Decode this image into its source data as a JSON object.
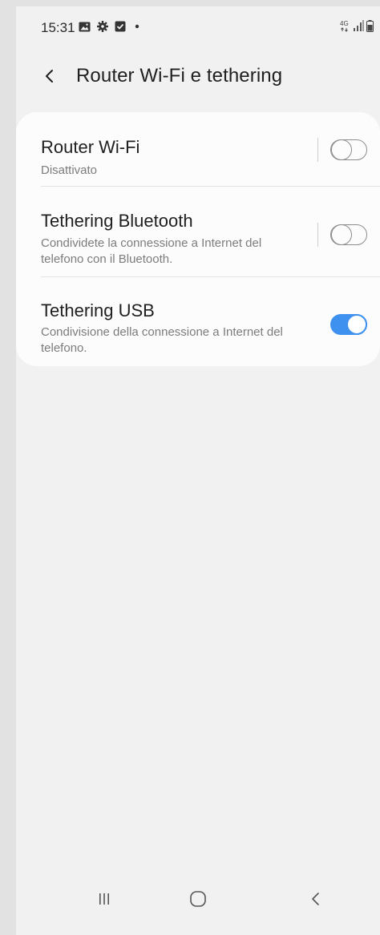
{
  "status_bar": {
    "time": "15:31",
    "network_label": "4G",
    "left_icons": [
      "gallery-icon",
      "settings-gear-icon",
      "checkbox-message-icon",
      "dot-icon"
    ],
    "right_icons": [
      "4g-icon",
      "signal-icon",
      "battery-icon"
    ]
  },
  "header": {
    "title": "Router Wi-Fi e tethering",
    "back_icon": "chevron-left-icon"
  },
  "settings": [
    {
      "title": "Router Wi-Fi",
      "subtitle": "Disattivato",
      "toggle_on": false
    },
    {
      "title": "Tethering Bluetooth",
      "subtitle": "Condividete la connessione a Internet del telefono con il Bluetooth.",
      "toggle_on": false
    },
    {
      "title": "Tethering USB",
      "subtitle": "Condivisione della connessione a Internet del telefono.",
      "toggle_on": true
    }
  ],
  "nav_bar": {
    "recents_icon": "recents-icon",
    "home_icon": "home-icon",
    "back_icon": "back-icon"
  },
  "colors": {
    "accent": "#3e91ee",
    "background": "#f1f1f1",
    "card": "#fcfcfc"
  }
}
